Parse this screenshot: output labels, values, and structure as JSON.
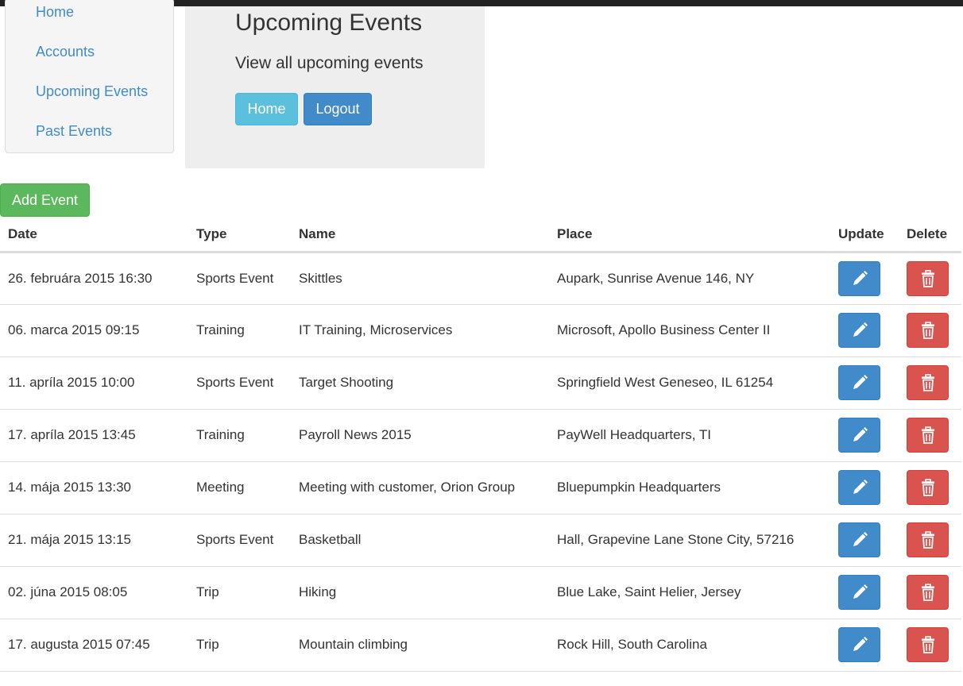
{
  "sidebar": {
    "items": [
      {
        "label": "Home"
      },
      {
        "label": "Accounts"
      },
      {
        "label": "Upcoming Events"
      },
      {
        "label": "Past Events"
      }
    ]
  },
  "jumbotron": {
    "title": "Upcoming Events",
    "subtitle": "View all upcoming events",
    "home_label": "Home",
    "logout_label": "Logout"
  },
  "toolbar": {
    "add_label": "Add Event"
  },
  "table": {
    "headers": [
      "Date",
      "Type",
      "Name",
      "Place",
      "Update",
      "Delete"
    ],
    "rows": [
      {
        "date": "26. februára 2015 16:30",
        "type": "Sports Event",
        "name": "Skittles",
        "place": "Aupark, Sunrise Avenue 146, NY"
      },
      {
        "date": "06. marca 2015 09:15",
        "type": "Training",
        "name": "IT Training, Microservices",
        "place": "Microsoft, Apollo Business Center II"
      },
      {
        "date": "11. apríla 2015 10:00",
        "type": "Sports Event",
        "name": "Target Shooting",
        "place": "Springfield West Geneseo, IL 61254"
      },
      {
        "date": "17. apríla 2015 13:45",
        "type": "Training",
        "name": "Payroll News 2015",
        "place": "PayWell Headquarters, TI"
      },
      {
        "date": "14. mája 2015 13:30",
        "type": "Meeting",
        "name": "Meeting with customer, Orion Group",
        "place": "Bluepumpkin Headquarters"
      },
      {
        "date": "21. mája 2015 13:15",
        "type": "Sports Event",
        "name": "Basketball",
        "place": "Hall, Grapevine Lane Stone City, 57216"
      },
      {
        "date": "02. júna 2015 08:05",
        "type": "Trip",
        "name": "Hiking",
        "place": "Blue Lake, Saint Helier, Jersey"
      },
      {
        "date": "17. augusta 2015 07:45",
        "type": "Trip",
        "name": "Mountain climbing",
        "place": "Rock Hill, South Carolina"
      }
    ]
  },
  "icons": {
    "update": "pencil-icon",
    "delete": "trash-icon"
  },
  "colors": {
    "link": "#428bca",
    "primary": "#428bca",
    "info": "#5bc0de",
    "success": "#5cb85c",
    "danger": "#d9534f"
  }
}
